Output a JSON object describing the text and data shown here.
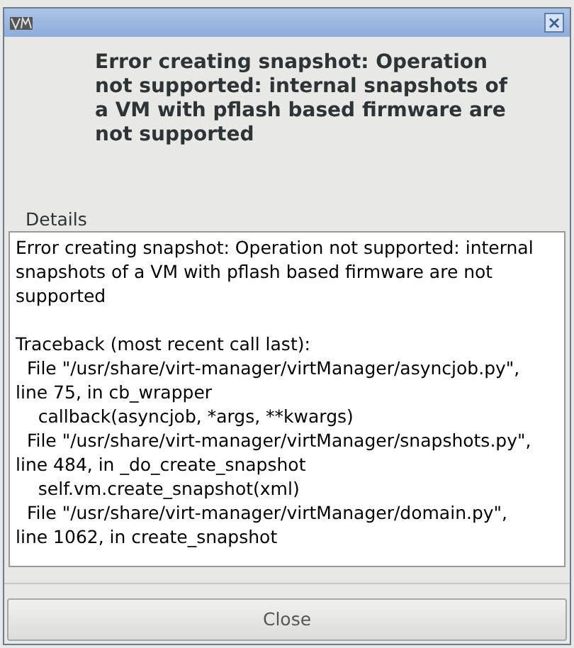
{
  "window": {
    "close_glyph": "×"
  },
  "message": "Error creating snapshot: Operation not supported: internal snapshots of a VM with pflash based firmware are not supported",
  "details": {
    "label": "Details",
    "paragraphs": [
      [
        "Error creating snapshot: Operation not supported: internal",
        "snapshots of a VM with pflash based firmware are not",
        "supported"
      ],
      [
        "Traceback (most recent call last):",
        "  File \"/usr/share/virt-manager/virtManager/asyncjob.py\",",
        "line 75, in cb_wrapper",
        "    callback(asyncjob, *args, **kwargs)",
        "  File \"/usr/share/virt-manager/virtManager/snapshots.py\",",
        "line 484, in _do_create_snapshot",
        "    self.vm.create_snapshot(xml)",
        "  File \"/usr/share/virt-manager/virtManager/domain.py\",",
        "line 1062, in create_snapshot"
      ]
    ]
  },
  "buttons": [
    {
      "label": "Close"
    }
  ]
}
